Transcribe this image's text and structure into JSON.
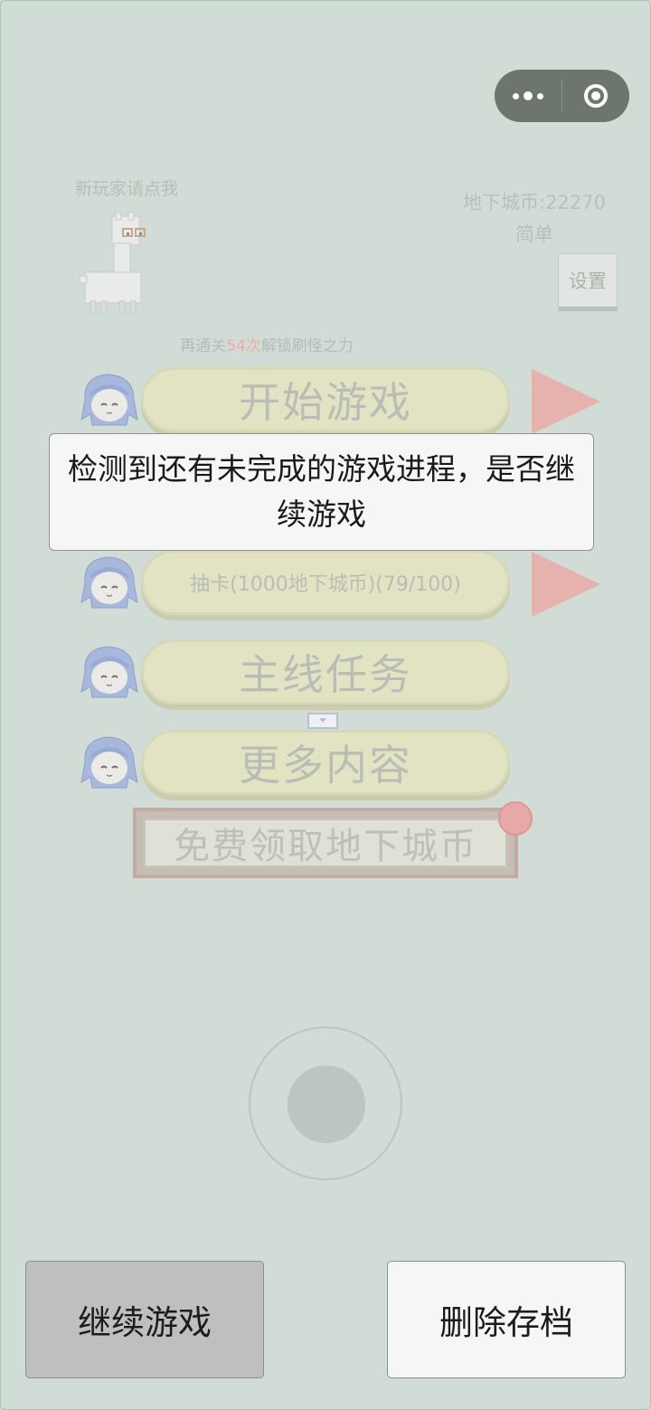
{
  "capsule": {
    "more_icon": "more-dots-icon",
    "close_icon": "target-circle-icon"
  },
  "menu": {
    "new_player_text": "新玩家请点我",
    "coins_text": "地下城币:22270",
    "difficulty_text": "简单",
    "settings_label": "设置",
    "unlock_prefix": "再通关",
    "unlock_count": "54次",
    "unlock_suffix": "解锁刷怪之力",
    "start_label": "开始游戏",
    "draw_label": "抽卡(1000地下城币)(79/100)",
    "main_quest_label": "主线任务",
    "more_label": "更多内容",
    "free_coins_label": "免费领取地下城币"
  },
  "dialog": {
    "message": "检测到还有未完成的游戏进程，是否继续游戏",
    "continue_label": "继续游戏",
    "delete_label": "删除存档"
  },
  "colors": {
    "background": "#d0dcd5",
    "pill": "#e2e3c2",
    "arrow": "#e6b2ae"
  }
}
